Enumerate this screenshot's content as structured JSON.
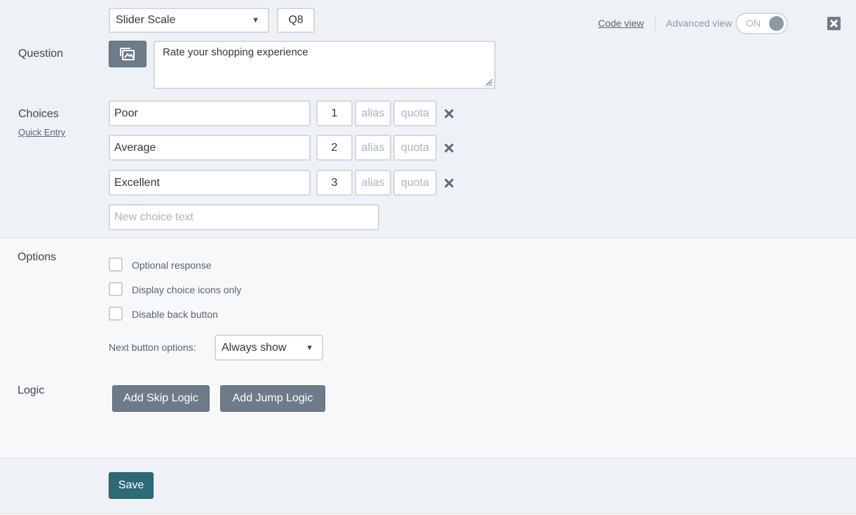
{
  "header": {
    "question_type": "Slider Scale",
    "question_id": "Q8",
    "code_view_label": "Code view",
    "advanced_view_label": "Advanced view",
    "advanced_view_toggle": "ON"
  },
  "question": {
    "label": "Question",
    "text": "Rate your shopping experience"
  },
  "choices": {
    "label": "Choices",
    "quick_entry_label": "Quick Entry",
    "items": [
      {
        "text": "Poor",
        "value": "1",
        "alias_placeholder": "alias",
        "quota_placeholder": "quota"
      },
      {
        "text": "Average",
        "value": "2",
        "alias_placeholder": "alias",
        "quota_placeholder": "quota"
      },
      {
        "text": "Excellent",
        "value": "3",
        "alias_placeholder": "alias",
        "quota_placeholder": "quota"
      }
    ],
    "new_choice_placeholder": "New choice text"
  },
  "options": {
    "label": "Options",
    "checkboxes": [
      {
        "label": "Optional response",
        "checked": false
      },
      {
        "label": "Display choice icons only",
        "checked": false
      },
      {
        "label": "Disable back button",
        "checked": false
      }
    ],
    "next_button_label": "Next button options:",
    "next_button_value": "Always show"
  },
  "logic": {
    "label": "Logic",
    "skip_button": "Add Skip Logic",
    "jump_button": "Add Jump Logic"
  },
  "footer": {
    "save_button": "Save"
  },
  "icons": {
    "media": "image-icon",
    "remove": "close-icon",
    "close_panel": "close-box-icon",
    "dropdown": "chevron-down-icon"
  }
}
